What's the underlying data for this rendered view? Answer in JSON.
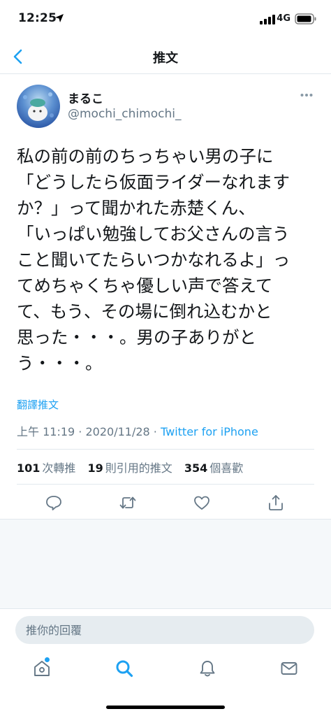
{
  "status_bar": {
    "time": "12:25",
    "network": "4G",
    "location_icon": "location-arrow-icon",
    "signal_icon": "signal-bars-icon",
    "battery_icon": "battery-icon"
  },
  "nav": {
    "title": "推文",
    "back_icon": "chevron-left-icon"
  },
  "tweet": {
    "author_name": "まるこ",
    "author_handle": "@mochi_chimochi_",
    "more_icon": "more-dots-icon",
    "text": "私の前の前のちっちゃい男の子に\n「どうしたら仮面ライダーなれます\nか？」って聞かれた赤楚くん、\n「いっぱい勉強してお父さんの言う\nこと聞いてたらいつかなれるよ」っ\nてめちゃくちゃ優しい声で答えて\nて、もう、その場に倒れ込むかと\n思った・・・。男の子ありがと\nう・・・。",
    "translate_label": "翻譯推文",
    "time": "上午 11:19",
    "date": "2020/11/28",
    "separator": "·",
    "source": "Twitter for iPhone"
  },
  "stats": {
    "retweets_count": "101",
    "retweets_label": "次轉推",
    "quotes_count": "19",
    "quotes_label": "則引用的推文",
    "likes_count": "354",
    "likes_label": "個喜歡"
  },
  "actions": {
    "reply_icon": "reply-bubble-icon",
    "retweet_icon": "retweet-icon",
    "like_icon": "heart-icon",
    "share_icon": "share-icon"
  },
  "reply": {
    "placeholder": "推你的回覆"
  },
  "tab_bar": {
    "items": [
      "home-icon",
      "search-icon",
      "notifications-bell-icon",
      "messages-mail-icon"
    ],
    "active": "search-icon"
  },
  "colors": {
    "accent": "#1da1f2",
    "text": "#14171a",
    "secondary": "#657786",
    "divider": "#e1e8ed"
  }
}
